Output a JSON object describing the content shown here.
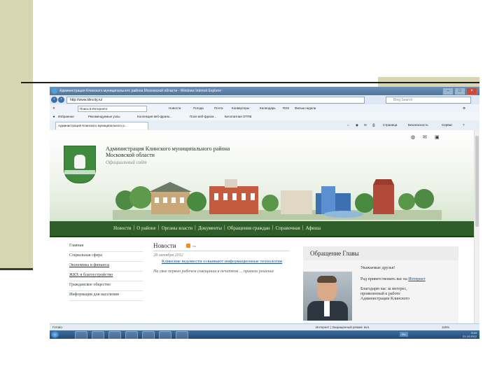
{
  "browser": {
    "title": "Администрация Клинского муниципального района Московской области - Windows Internet Explorer",
    "url": "http://www.klincity.ru/",
    "search_placeholder": "Bing Search",
    "toolbar_search_field": "Поиск в Интернете",
    "toolbar_items": [
      "Новости",
      "Погода",
      "Почта",
      "Конвертеры",
      "Календарь",
      "RSS",
      "Фильм недели"
    ],
    "favorites_bar": [
      "Избранное",
      "Рекомендуемые узлы",
      "Коллекция веб-фрагм...",
      "Поле веб-фрагм...",
      "Бесплатная ОТПВ"
    ],
    "tab_label": "Администрация Клинского муниципального р...",
    "command_bar": [
      "Страница",
      "Безопасность",
      "Сервис"
    ]
  },
  "site": {
    "admin_title": "Администрация Клинского муниципального района Московской области",
    "subtitle": "Официальный сайт",
    "nav": [
      "Новости",
      "О районе",
      "Органы власти",
      "Документы",
      "Обращения граждан",
      "Справочная",
      "Афиша"
    ],
    "sidebar": [
      "Главная",
      "Социальная сфера",
      "Экономика и финансы",
      "ЖКХ и благоустройство",
      "Гражданское общество",
      "Информация для населения"
    ],
    "news": {
      "heading": "Новости",
      "rss_label": "rss",
      "date": "28 октября 2012",
      "link": "Клинские ведомости осваивают информационные технологии",
      "text": "На свое первом рабочем совещании в печатном ... приняли решение"
    },
    "appeal": {
      "heading": "Обращение Главы",
      "greeting": "Уважаемые друзья!",
      "line2_prefix": "Рад приветствовать вас на",
      "line2_link": "Интернет",
      "line3": "Благодарю вас за интерес,",
      "line4": "проявленный к работе",
      "line5": "Администрации Клинского"
    }
  },
  "status": {
    "left": "Готово",
    "zone": "Интернет | Защищенный режим: вкл.",
    "zoom": "115%"
  },
  "taskbar": {
    "lang": "RU",
    "time": "9:44",
    "date": "21.10.2012"
  },
  "colors": {
    "slide_band": "#d8d6b2",
    "nav_green": "#2f5e2a",
    "title_blue": "#4f7399"
  }
}
